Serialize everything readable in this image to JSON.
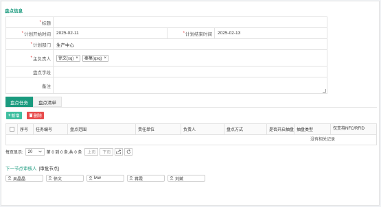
{
  "section_title": "盘点信息",
  "form": {
    "title_label": "标题",
    "title_value": "",
    "plan_start_label": "计划开始时间",
    "plan_start_value": "2025-02-11",
    "plan_end_label": "计划结束时间",
    "plan_end_value": "2025-02-13",
    "dept_label": "计划部门",
    "dept_value": "生产中心",
    "owner_label": "主负责人",
    "owners": [
      "徐文(xq)",
      "秦菓(qxq)"
    ],
    "field_label": "盘点字段",
    "field_value": "",
    "remark_label": "备注",
    "remark_value": ""
  },
  "tabs": [
    "盘点任务",
    "盘点清单"
  ],
  "toolbar": {
    "add_label": "新增",
    "delete_label": "删除"
  },
  "grid": {
    "columns": [
      "序号",
      "任务编号",
      "盘点范围",
      "责任单位",
      "负责人",
      "盘点方式",
      "是否开启抽盘",
      "抽盘类型",
      "仅支持NFC/RFID"
    ],
    "empty_text": "没有相关记录"
  },
  "pager": {
    "per_page_label": "每页显示:",
    "per_page_value": "20",
    "page_info": "第 0 到 0 条,共 0 条",
    "prev_label": "上页",
    "next_label": "下页"
  },
  "next_approver": {
    "title": "下一节点审核人",
    "note": "[审批节点]"
  },
  "approvers": [
    "吴晶晶",
    "徐文",
    "lww",
    "蒋霞",
    "刘斌"
  ],
  "colors": {
    "accent": "#1a9a7e",
    "add": "#3fbfa0",
    "delete": "#e84c4c",
    "required": "#e23b3b"
  }
}
